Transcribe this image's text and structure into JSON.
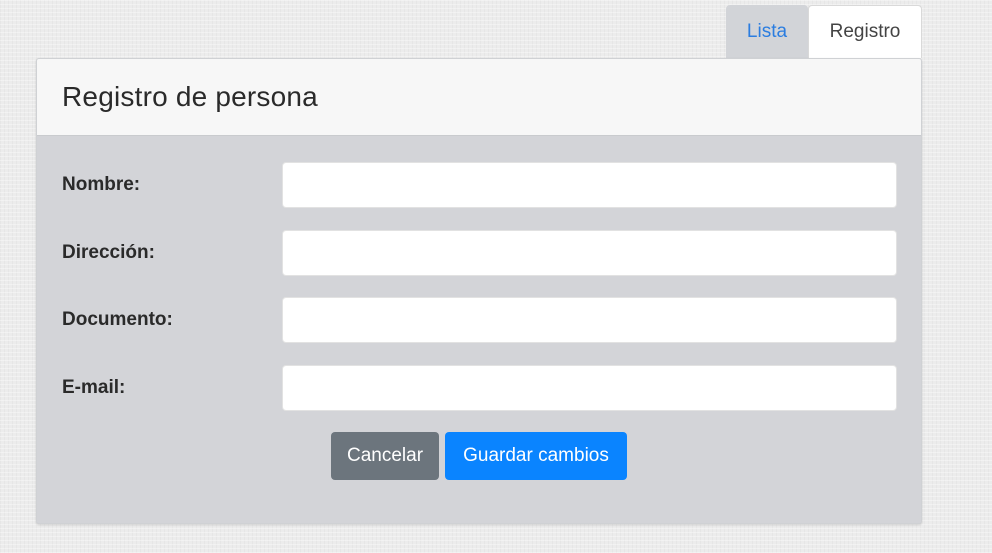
{
  "tabs": {
    "lista": "Lista",
    "registro": "Registro"
  },
  "card": {
    "title": "Registro de persona"
  },
  "form": {
    "fields": [
      {
        "label": "Nombre:",
        "value": "",
        "placeholder": ""
      },
      {
        "label": "Dirección:",
        "value": "",
        "placeholder": ""
      },
      {
        "label": "Documento:",
        "value": "",
        "placeholder": ""
      },
      {
        "label": "E-mail:",
        "value": "",
        "placeholder": ""
      }
    ],
    "cancel_label": "Cancelar",
    "save_label": "Guardar cambios"
  },
  "colors": {
    "primary": "#0a84ff",
    "secondary": "#6c757d",
    "active_tab_text": "#2b7de0",
    "card_body_bg": "#d3d4d8"
  }
}
